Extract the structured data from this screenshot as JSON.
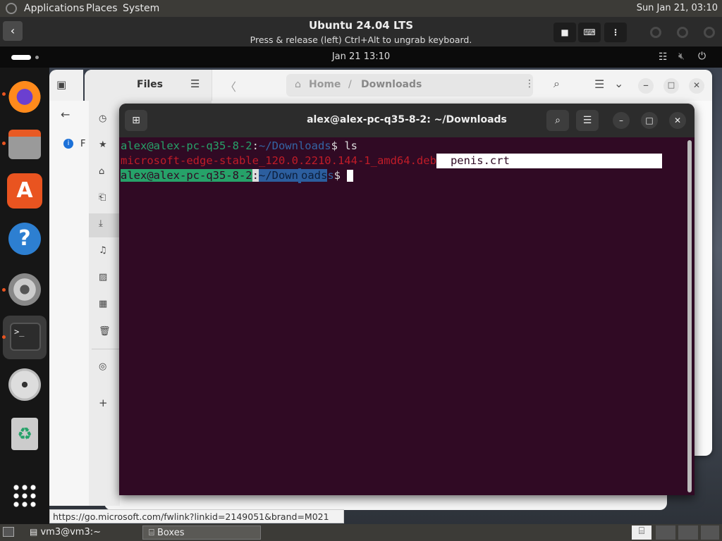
{
  "host": {
    "menu": [
      "Applications",
      "Places",
      "System"
    ],
    "clock": "Sun Jan 21, 03:10"
  },
  "boxes": {
    "title": "Ubuntu 24.04 LTS",
    "subtitle": "Press & release (left) Ctrl+Alt to ungrab keyboard."
  },
  "guest": {
    "clock": "Jan 21  13:10"
  },
  "files": {
    "side_title": "Files",
    "path": [
      "Home",
      "Downloads"
    ],
    "sidebar_items": [
      {
        "icon": "recent-icon",
        "label": "Recent"
      },
      {
        "icon": "star-icon",
        "label": "Starred"
      },
      {
        "icon": "home-icon",
        "label": "Home"
      },
      {
        "icon": "documents-icon",
        "label": "Documents"
      },
      {
        "icon": "download-icon",
        "label": "Downloads"
      },
      {
        "icon": "music-icon",
        "label": "Music"
      },
      {
        "icon": "pictures-icon",
        "label": "Pictures"
      },
      {
        "icon": "videos-icon",
        "label": "Videos"
      },
      {
        "icon": "trash-icon",
        "label": "Trash"
      },
      {
        "icon": "disc-icon",
        "label": "Ubuntu"
      },
      {
        "icon": "plus-icon",
        "label": "Other Locations"
      }
    ],
    "banner_initial": "F"
  },
  "terminal": {
    "title": "alex@alex-pc-q35-8-2: ~/Downloads",
    "user_host": "alex@alex-pc-q35-8-2",
    "colon": ":",
    "path": "~/Downloads",
    "prompt": "$ ",
    "cmd1": "ls",
    "file_deb": "microsoft-edge-stable_120.0.2210.144-1_amd64.deb",
    "file_crt": "penis.crt",
    "path_sel_part": "~/Down",
    "path_sel_part2": "oads",
    "path_rest": "s"
  },
  "status_url": "https://go.microsoft.com/fwlink?linkid=2149051&brand=M021",
  "taskbar": [
    {
      "label": "vm3@vm3:~"
    },
    {
      "label": "Boxes"
    }
  ],
  "colors": {
    "terminal_bg": "#300a24",
    "prompt_green": "#26a269",
    "path_blue": "#3465a4",
    "deb_red": "#c01c28",
    "ubuntu_orange": "#e95420"
  }
}
